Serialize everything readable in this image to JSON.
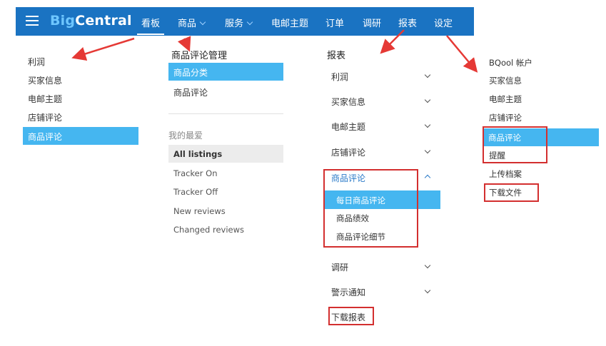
{
  "header": {
    "logo_big": "Big",
    "logo_central": "Central",
    "nav": [
      {
        "label": "看板",
        "dropdown": false
      },
      {
        "label": "商品",
        "dropdown": true
      },
      {
        "label": "服务",
        "dropdown": true
      },
      {
        "label": "电邮主题",
        "dropdown": false
      },
      {
        "label": "订单",
        "dropdown": false
      },
      {
        "label": "调研",
        "dropdown": false
      },
      {
        "label": "报表",
        "dropdown": false
      },
      {
        "label": "设定",
        "dropdown": false
      }
    ]
  },
  "dashboard_menu": {
    "items": [
      "利润",
      "买家信息",
      "电邮主题",
      "店铺评论",
      "商品评论"
    ],
    "active": "商品评论"
  },
  "product_menu": {
    "title": "商品评论管理",
    "items": [
      "商品分类",
      "商品评论"
    ],
    "favorites_title": "我的最爱",
    "favorites": [
      "All listings",
      "Tracker On",
      "Tracker Off",
      "New reviews",
      "Changed reviews"
    ]
  },
  "report_menu": {
    "title": "报表",
    "items_top": [
      "利润",
      "买家信息",
      "电邮主题",
      "店铺评论"
    ],
    "expanded_label": "商品评论",
    "expanded_items": [
      "每日商品评论",
      "商品绩效",
      "商品评论细节"
    ],
    "items_bottom": [
      "调研",
      "警示通知"
    ],
    "download": "下载报表"
  },
  "settings_menu": {
    "items": [
      "BQool 帐户",
      "买家信息",
      "电邮主题",
      "店铺评论",
      "商品评论",
      "提醒",
      "上传档案",
      "下载文件"
    ],
    "active": "商品评论"
  },
  "colors": {
    "header_bg": "#1a73c2",
    "active_bg": "#45b6f0",
    "annotation_red": "#d32f2f"
  }
}
